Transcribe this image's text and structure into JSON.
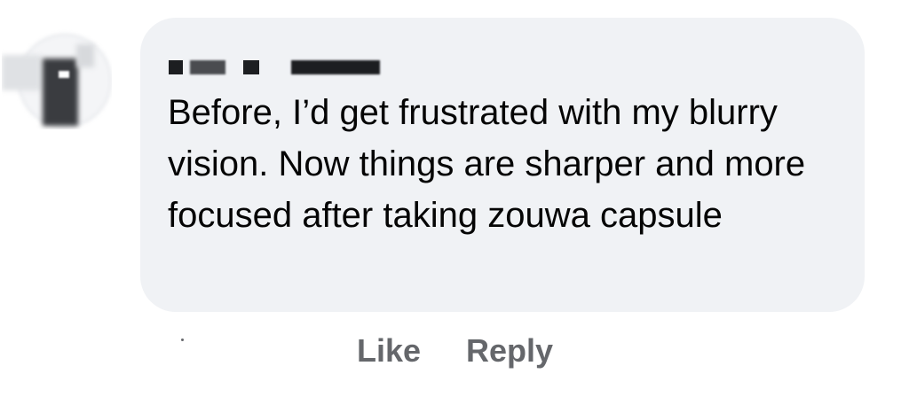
{
  "comment": {
    "author_name": "",
    "text": "Before, I’d get frustrated with my blurry vision. Now things are sharper and more focused after taking zouwa capsule"
  },
  "actions": {
    "like_label": "Like",
    "reply_label": "Reply"
  },
  "colors": {
    "bubble_background": "#f0f2f5",
    "text": "#050505",
    "action_text": "#65676b"
  }
}
